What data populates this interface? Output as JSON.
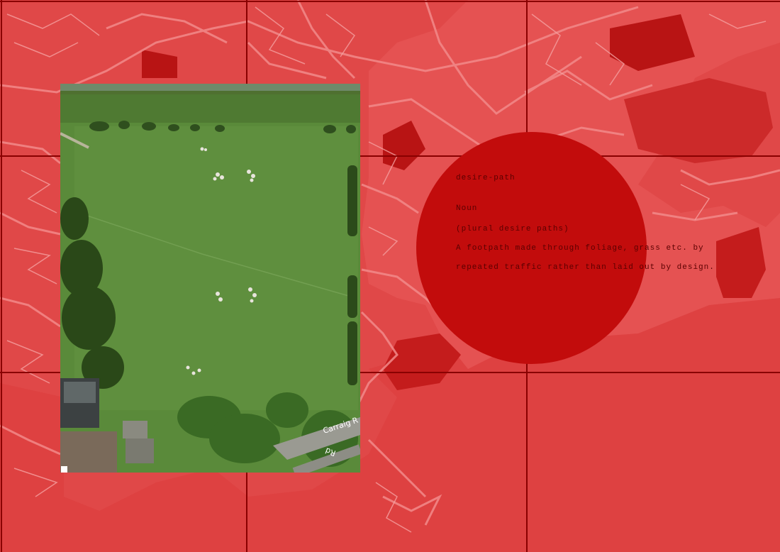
{
  "definition": {
    "word": "desire-path",
    "part_of_speech": "Noun",
    "plural": "(plural desire paths)",
    "body_line_1": "A footpath made through foliage, grass etc. by",
    "body_line_2": "repeated traffic rather than laid out by design."
  },
  "photo": {
    "road_label_1": "Carraig R",
    "road_label_2": "Rd"
  },
  "colors": {
    "map_background": "#e04848",
    "map_roads": "#f07a7a",
    "map_dark": "#b01010",
    "grid_lines": "#8a0000",
    "circle": "#c20c0c",
    "grass": "#5a8a3a"
  },
  "icons": {
    "marker": "white-square-marker"
  }
}
